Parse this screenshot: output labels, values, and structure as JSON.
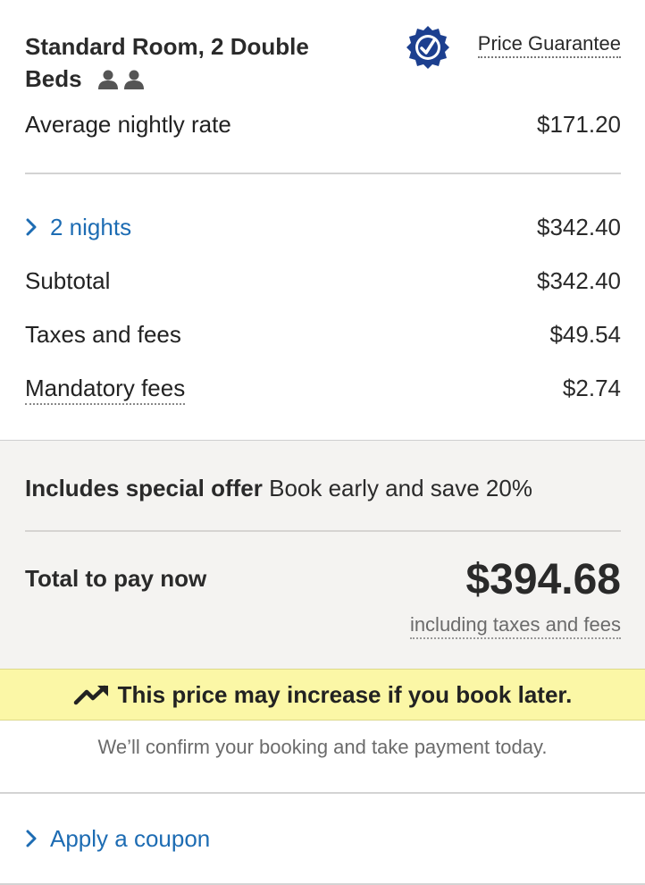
{
  "room": {
    "title": "Standard Room, 2 Double Beds",
    "guest_icons": [
      "person-icon",
      "person-icon"
    ]
  },
  "price_guarantee": {
    "label": "Price Guarantee",
    "icon": "checkmark-badge-icon",
    "badge_color": "#1c3f8f"
  },
  "rates": {
    "average_label": "Average nightly rate",
    "average_value": "$171.20",
    "nights_label": "2 nights",
    "nights_value": "$342.40",
    "subtotal_label": "Subtotal",
    "subtotal_value": "$342.40",
    "taxes_label": "Taxes and fees",
    "taxes_value": "$49.54",
    "mandatory_label": "Mandatory fees",
    "mandatory_value": "$2.74"
  },
  "offer": {
    "bold": "Includes special offer",
    "text": "Book early and save 20%"
  },
  "total": {
    "label": "Total to pay now",
    "amount": "$394.68",
    "note": "including taxes and fees"
  },
  "warning": {
    "text": "This price may increase if you book later.",
    "icon": "trending-up-icon",
    "background": "#fbf7a6"
  },
  "confirm_text": "We’ll confirm your booking and take payment today.",
  "coupon": {
    "label": "Apply a coupon"
  },
  "colors": {
    "link": "#1d6cb3",
    "text": "#2a2a2a",
    "muted": "#6b6b6b",
    "grey_bg": "#f4f3f1"
  }
}
